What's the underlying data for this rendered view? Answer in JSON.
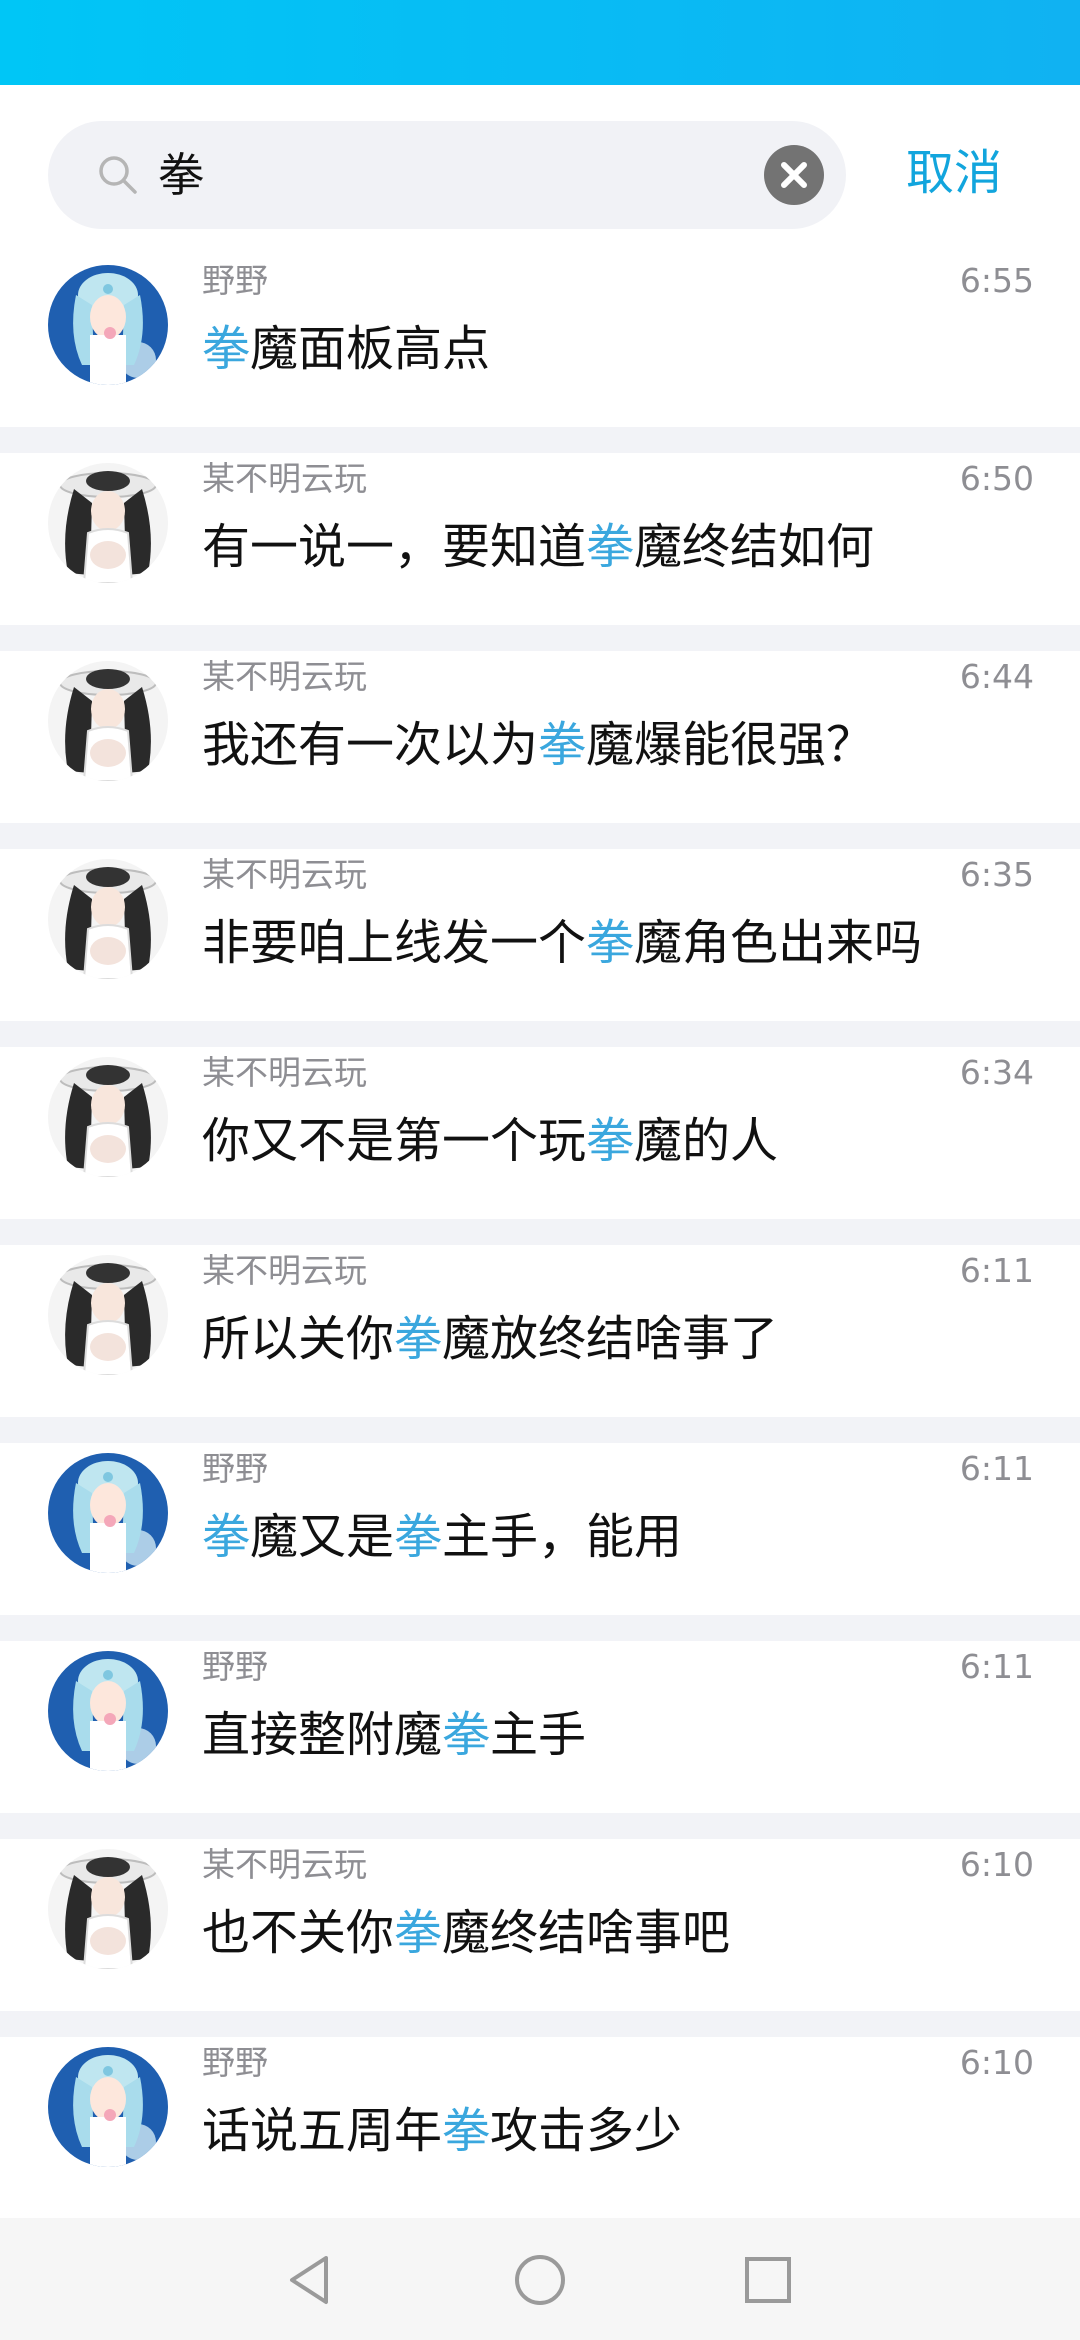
{
  "search": {
    "query": "拳",
    "cancel_label": "取消"
  },
  "results": [
    {
      "sender": "野野",
      "time": "6:55",
      "avatar": "anime-blue-girl",
      "segments": [
        {
          "t": "拳",
          "hl": true
        },
        {
          "t": "魔面板高点",
          "hl": false
        }
      ]
    },
    {
      "sender": "某不明云玩",
      "time": "6:50",
      "avatar": "anime-dark-hair-girl",
      "segments": [
        {
          "t": "有一说一，要知道",
          "hl": false
        },
        {
          "t": "拳",
          "hl": true
        },
        {
          "t": "魔终结如何",
          "hl": false
        }
      ]
    },
    {
      "sender": "某不明云玩",
      "time": "6:44",
      "avatar": "anime-dark-hair-girl",
      "segments": [
        {
          "t": "我还有一次以为",
          "hl": false
        },
        {
          "t": "拳",
          "hl": true
        },
        {
          "t": "魔爆能很强？",
          "hl": false
        }
      ]
    },
    {
      "sender": "某不明云玩",
      "time": "6:35",
      "avatar": "anime-dark-hair-girl",
      "segments": [
        {
          "t": "非要咱上线发一个",
          "hl": false
        },
        {
          "t": "拳",
          "hl": true
        },
        {
          "t": "魔角色出来吗",
          "hl": false
        }
      ]
    },
    {
      "sender": "某不明云玩",
      "time": "6:34",
      "avatar": "anime-dark-hair-girl",
      "segments": [
        {
          "t": "你又不是第一个玩",
          "hl": false
        },
        {
          "t": "拳",
          "hl": true
        },
        {
          "t": "魔的人",
          "hl": false
        }
      ]
    },
    {
      "sender": "某不明云玩",
      "time": "6:11",
      "avatar": "anime-dark-hair-girl",
      "segments": [
        {
          "t": "所以关你",
          "hl": false
        },
        {
          "t": "拳",
          "hl": true
        },
        {
          "t": "魔放终结啥事了",
          "hl": false
        }
      ]
    },
    {
      "sender": "野野",
      "time": "6:11",
      "avatar": "anime-blue-girl",
      "segments": [
        {
          "t": "拳",
          "hl": true
        },
        {
          "t": "魔又是",
          "hl": false
        },
        {
          "t": "拳",
          "hl": true
        },
        {
          "t": "主手，能用",
          "hl": false
        }
      ]
    },
    {
      "sender": "野野",
      "time": "6:11",
      "avatar": "anime-blue-girl",
      "segments": [
        {
          "t": "直接整附魔",
          "hl": false
        },
        {
          "t": "拳",
          "hl": true
        },
        {
          "t": "主手",
          "hl": false
        }
      ]
    },
    {
      "sender": "某不明云玩",
      "time": "6:10",
      "avatar": "anime-dark-hair-girl",
      "segments": [
        {
          "t": "也不关你",
          "hl": false
        },
        {
          "t": "拳",
          "hl": true
        },
        {
          "t": "魔终结啥事吧",
          "hl": false
        }
      ]
    },
    {
      "sender": "野野",
      "time": "6:10",
      "avatar": "anime-blue-girl",
      "segments": [
        {
          "t": "话说五周年",
          "hl": false
        },
        {
          "t": "拳",
          "hl": true
        },
        {
          "t": "攻击多少",
          "hl": false
        }
      ]
    }
  ],
  "nav": {
    "back_icon": "back-triangle-icon",
    "home_icon": "home-circle-icon",
    "recents_icon": "recents-square-icon"
  },
  "colors": {
    "status_bar": "#00c6f6",
    "highlight": "#3aa7de",
    "cancel": "#12a5dd"
  }
}
